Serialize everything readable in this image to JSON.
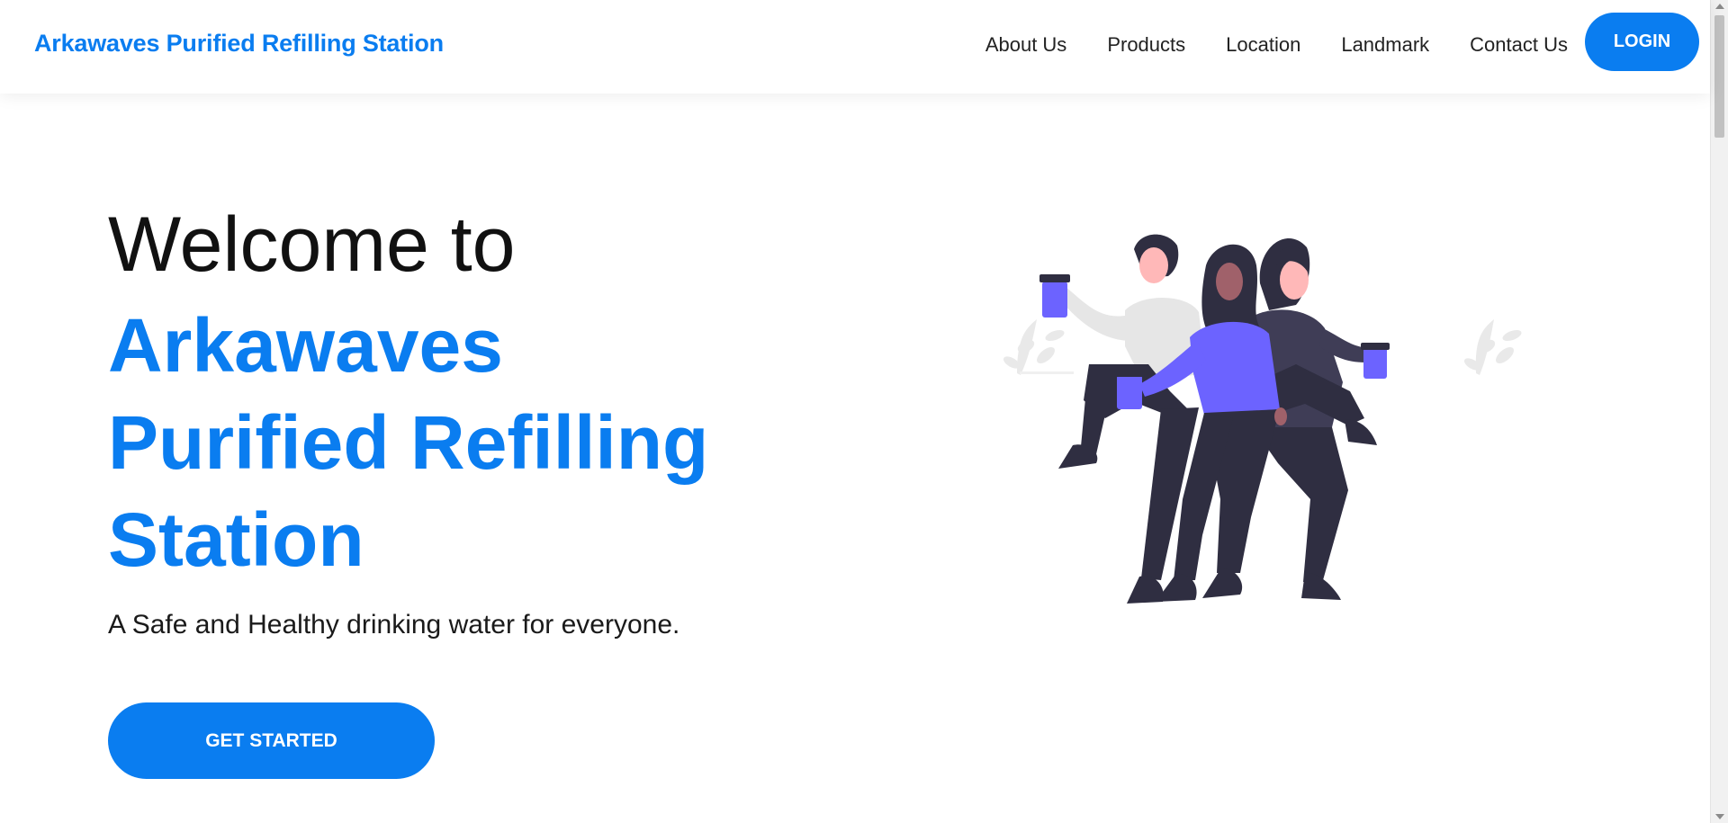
{
  "header": {
    "brand": "Arkawaves Purified Refilling Station",
    "nav": [
      "About Us",
      "Products",
      "Location",
      "Landmark",
      "Contact Us"
    ],
    "login_label": "LOGIN"
  },
  "hero": {
    "title_line1": "Welcome to",
    "title_highlight": "Arkawaves Purified Refilling Station",
    "subtitle": "A Safe and Healthy drinking water for everyone.",
    "cta_label": "GET STARTED"
  },
  "colors": {
    "accent": "#0a7df0",
    "illustration_purple": "#6c63ff",
    "illustration_dark": "#2f2e41"
  },
  "icons": {
    "illustration": "people-holding-cups-illustration"
  }
}
